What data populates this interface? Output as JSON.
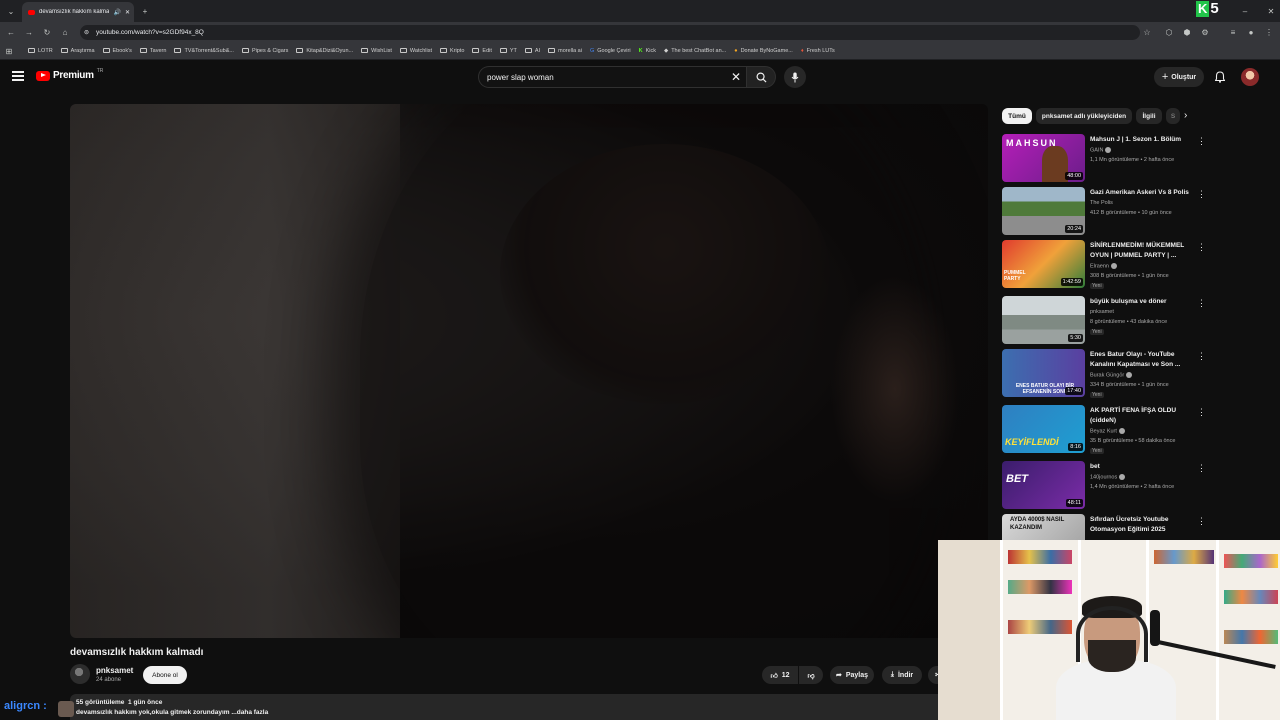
{
  "browser": {
    "tab_title": "devamsızlık hakkım kalmadı",
    "url": "youtube.com/watch?v=s2GDf94x_8Q",
    "bookmarks": [
      "LOTR",
      "Araştırma",
      "Ebook's",
      "Tavern",
      "TV&Torrent&Sub&...",
      "Pipes & Cigars",
      "Kitap&Dizi&Oyun...",
      "WishList",
      "Watchlist",
      "Kripto",
      "Edit",
      "YT",
      "AI",
      "morella ai",
      "Google Çeviri",
      "Kick",
      "The best ChatBot an...",
      "Donate ByNoGame...",
      "Fresh LUTs"
    ],
    "overlay_logo": {
      "k": "K",
      "n": "5"
    }
  },
  "header": {
    "logo_text": "Premium",
    "logo_region": "TR",
    "search_value": "power slap woman",
    "create_label": "Oluştur"
  },
  "video": {
    "title": "devamsızlık hakkım kalmadı",
    "channel": "pnksamet",
    "subscribers": "24 abone",
    "subscribe_label": "Abone ol",
    "likes": "12",
    "share_label": "Paylaş",
    "download_label": "İndir",
    "views": "55 görüntüleme",
    "age": "1 gün önce",
    "description": "devamsızlık hakkım yok,okula gitmek zorundayım",
    "more_label": "...daha fazla"
  },
  "chat": {
    "username": "aligrcn :"
  },
  "sidebar": {
    "chips": [
      "Tümü",
      "pnksamet adlı yükleyiciden",
      "İlgili",
      "S"
    ],
    "recommendations": [
      {
        "title": "Mahsun J | 1. Sezon 1. Bölüm",
        "channel": "GAIN",
        "verified": true,
        "stats": "1,1 Mn görüntüleme • 2 hafta önce",
        "duration": "48:00",
        "new": ""
      },
      {
        "title": "Gazi Amerikan Askeri Vs 8 Polis",
        "channel": "The Polis",
        "verified": false,
        "stats": "412 B görüntüleme • 10 gün önce",
        "duration": "20:24",
        "new": ""
      },
      {
        "title": "SİNİRLENMEDİM! MÜKEMMEL OYUN | PUMMEL PARTY | ...",
        "channel": "Elraenn",
        "verified": true,
        "stats": "308 B görüntüleme • 1 gün önce",
        "duration": "1:42:59",
        "new": "Yeni"
      },
      {
        "title": "büyük buluşma ve döner",
        "channel": "pnksamet",
        "verified": false,
        "stats": "8 görüntüleme • 43 dakika önce",
        "duration": "5:30",
        "new": "Yeni"
      },
      {
        "title": "Enes Batur Olayı - YouTube Kanalını Kapatması ve Son ...",
        "channel": "Burak Güngör",
        "verified": true,
        "stats": "334 B görüntüleme • 1 gün önce",
        "duration": "17:40",
        "new": "Yeni"
      },
      {
        "title": "AK PARTİ FENA İFŞA OLDU (ciddeN)",
        "channel": "Beyaz Kurt",
        "verified": true,
        "stats": "35 B görüntüleme • 58 dakika önce",
        "duration": "8:16",
        "new": "Yeni"
      },
      {
        "title": "bet",
        "channel": "140journos",
        "verified": true,
        "stats": "1,4 Mn görüntüleme • 2 hafta önce",
        "duration": "48:11",
        "new": ""
      },
      {
        "title": "Sıfırdan Ücretsiz Youtube Otomasyon Eğitimi 2025",
        "channel": "",
        "verified": false,
        "stats": "",
        "duration": "",
        "new": ""
      }
    ],
    "thumb_texts": [
      "MAHSUN",
      "",
      "PUMMEL PARTY",
      "",
      "ENES BATUR OLAYI BİR EFSANENİN SONU",
      "KEYİFLENDİ",
      "BET",
      "AYDA 4000$ NASIL KAZANDIM"
    ]
  },
  "colors": {
    "brand_red": "#ff0000",
    "background": "#0f0f0f",
    "chat_blue": "#3b88ff",
    "k5_green": "#22c44a"
  }
}
